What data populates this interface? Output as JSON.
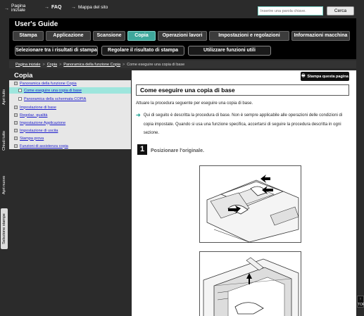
{
  "topbar": {
    "links": [
      "Pagina iniziale",
      "FAQ",
      "Mappa del sito"
    ],
    "search_placeholder": "Inserire una parola chiave.",
    "search_button": "Cerca"
  },
  "header": {
    "title": "User's Guide",
    "tabs": [
      "Stampa",
      "Applicazione",
      "Scansione",
      "Copia",
      "Operazioni lavori",
      "Impostazioni e regolazioni",
      "Informazioni macchina"
    ],
    "active_tab": "Copia",
    "subtabs": [
      "Selezionare tra i risultati di stampa",
      "Regolare il risultato di stampa",
      "Utilizzare funzioni utili"
    ]
  },
  "breadcrumb": [
    "Pagina iniziale",
    "Copia",
    "Panoramica della funzione Copia",
    "Come eseguire una copia di base"
  ],
  "side_tabs": [
    "Apri tutto",
    "Chiudi tutto",
    "Apri nuovo",
    "Selezione stampe"
  ],
  "sidebar": {
    "title": "Copia",
    "items": [
      {
        "label": "Panoramica della funzione Copia",
        "level": 0
      },
      {
        "label": "Come eseguire una copia di base",
        "level": 1,
        "current": true
      },
      {
        "label": "Panoramica della schermata COPIA",
        "level": 1
      },
      {
        "label": "Impostazione di base",
        "level": 0
      },
      {
        "label": "Regolaz. qualità",
        "level": 0
      },
      {
        "label": "Impostazione Applicazione",
        "level": 0
      },
      {
        "label": "Impostazione di uscita",
        "level": 0
      },
      {
        "label": "Stampa prova",
        "level": 0
      },
      {
        "label": "Funzioni di assistenza copia",
        "level": 0
      }
    ]
  },
  "content": {
    "print_button": "Stampa questa pagina",
    "heading": "Come eseguire una copia di base",
    "intro": "Attuare la procedura seguente per eseguire una copia di base.",
    "note": "Qui di seguito è descritta la procedura di base. Non è sempre applicabile alle operazioni delle condizioni di copia impostate. Quando si usa una funzione specifica, accertarsi di seguire la procedura descritta in ogni sezione.",
    "step_number": "1",
    "step_text": "Posizionare l'originale."
  },
  "top_button": "TOP",
  "colors": {
    "accent": "#3fa79b",
    "highlight": "#9ee6dd",
    "background": "#2b2b2b"
  }
}
